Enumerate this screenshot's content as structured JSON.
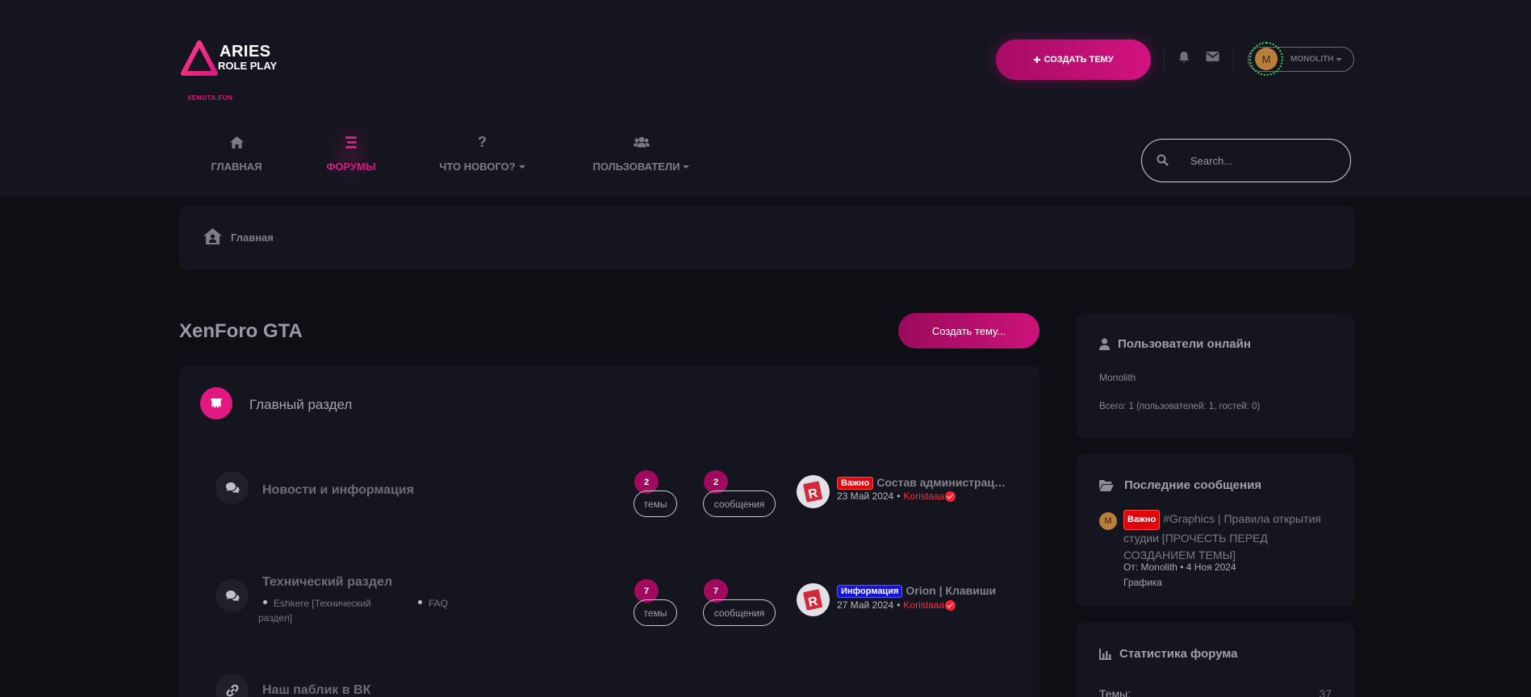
{
  "header": {
    "logo_title": "ARIES",
    "logo_subtitle": "ROLE PLAY",
    "logo_domain": "XENOTA.FUN",
    "create_topic_label": "СОЗДАТЬ ТЕМУ",
    "bell_icon": "bell-icon",
    "mail_icon": "envelope-icon",
    "user_initial": "M",
    "username": "MONOLITH"
  },
  "nav": {
    "items": [
      {
        "label": "ГЛАВНАЯ",
        "icon": "home-icon"
      },
      {
        "label": "ФОРУМЫ",
        "icon": "bars-icon"
      },
      {
        "label": "ЧТО НОВОГО?",
        "icon": "question-icon"
      },
      {
        "label": "ПОЛЬЗОВАТЕЛИ",
        "icon": "users-icon"
      }
    ],
    "search_placeholder": "Search..."
  },
  "breadcrumb": {
    "label": "Главная"
  },
  "main": {
    "title": "XenForo GTA",
    "new_thread_label": "Создать тему...",
    "category": {
      "title": "Главный раздел"
    },
    "nodes": [
      {
        "title": "Новости и информация",
        "threads": "2",
        "threads_label": "темы",
        "messages": "2",
        "messages_label": "сообщения",
        "last_tag": "Важно",
        "last_title": "Состав администрации",
        "last_date": "23 Май 2024",
        "last_sep": "•",
        "last_author": "Koristaaa"
      },
      {
        "title": "Технический раздел",
        "subforums": [
          "Eshkere [Технический раздел]",
          "FAQ"
        ],
        "threads": "7",
        "threads_label": "темы",
        "messages": "7",
        "messages_label": "сообщения",
        "last_tag": "Информация",
        "last_title": "Orion | Клавиши",
        "last_date": "27 Май 2024",
        "last_sep": "•",
        "last_author": "Koristaaa"
      },
      {
        "title": "Наш паблик в ВК"
      }
    ]
  },
  "sidebar": {
    "online": {
      "title": "Пользователи онлайн",
      "user": "Monolith",
      "summary": "Всего: 1 (пользователей: 1, гостей: 0)"
    },
    "latest": {
      "title": "Последние сообщения",
      "avatar_initial": "M",
      "tag": "Важно",
      "post_title": "#Graphics | Правила открытия студии [ПРОЧЕСТЬ ПЕРЕД СОЗДАНИЕМ ТЕМЫ]",
      "meta": "От: Monolith • 4 Ноя 2024",
      "forum": "Графика"
    },
    "stats": {
      "title": "Статистика форума",
      "rows": [
        {
          "label": "Темы:",
          "value": "37"
        }
      ]
    }
  },
  "colors": {
    "accent": "#d81b83",
    "background": "#0e0e15",
    "panel": "#151520",
    "tag_red": "#e0060b",
    "tag_blue": "#1414d8"
  }
}
